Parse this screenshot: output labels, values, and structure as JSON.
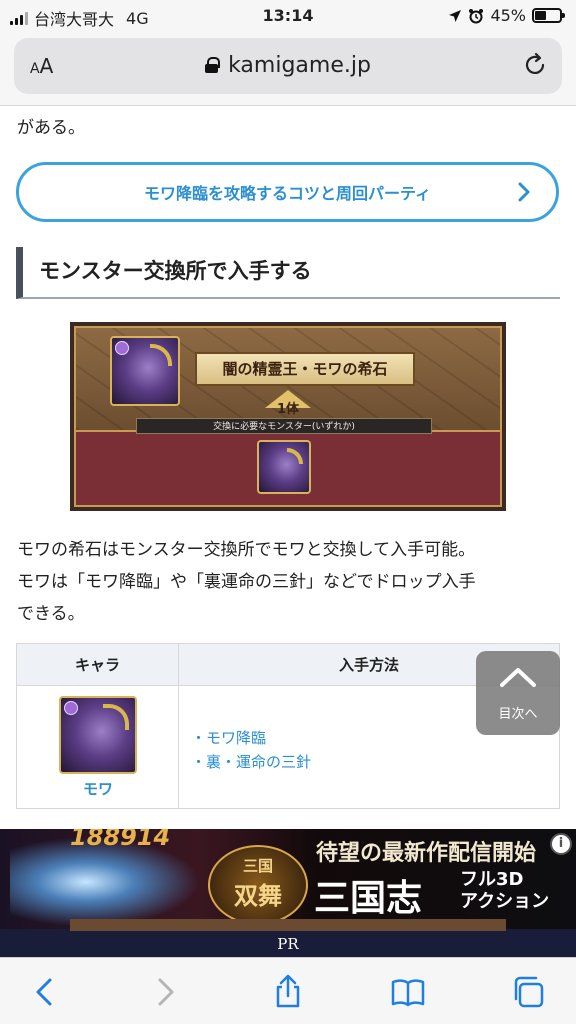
{
  "status_bar": {
    "carrier": "台湾大哥大",
    "network": "4G",
    "time": "13:14",
    "battery": "45%",
    "battery_level": 0.45
  },
  "browser": {
    "aa_label": "AA",
    "url": "kamigame.jp"
  },
  "article": {
    "leading_text": "がある。",
    "link_button": "モワ降臨を攻略するコツと周回パーティ",
    "section_heading": "モンスター交換所で入手する",
    "image": {
      "title_plate": "闇の精霊王・モワの希石",
      "count": "1体",
      "need_text": "交換に必要なモンスター(いずれか)"
    },
    "paragraph_lines": [
      "モワの希石はモンスター交換所でモワと交換して入手可能。",
      "モワは「モワ降臨」や「裏運命の三針」などでドロップ入手",
      "できる。"
    ],
    "table": {
      "headers": [
        "キャラ",
        "入手方法"
      ],
      "char_name": "モワ",
      "methods": [
        "・モワ降臨",
        "・裏・運命の三針"
      ]
    },
    "next_button": "目次へ"
  },
  "ad": {
    "score": "188914",
    "logo_top": "三国",
    "logo_bottom": "双舞",
    "headline": "待望の最新作配信開始",
    "big_text": "三国志",
    "side_line1": "フル3D",
    "side_line2": "アクション",
    "info_icon": "i",
    "pr_label": "PR"
  }
}
